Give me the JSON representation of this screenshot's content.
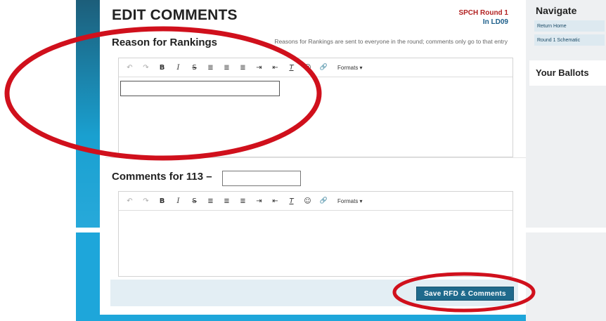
{
  "page": {
    "title": "EDIT COMMENTS",
    "round_name": "SPCH Round 1",
    "room": "In LD09"
  },
  "rfd": {
    "heading": "Reason for Rankings",
    "note": "Reasons for Rankings are sent to everyone in the round; comments only go to that entry",
    "input_value": ""
  },
  "comments": {
    "heading": "Comments for 113 –",
    "entry_name_value": ""
  },
  "toolbar": {
    "undo": "↶",
    "redo": "↷",
    "bold": "B",
    "italic": "I",
    "strike": "S",
    "align_left": "≣",
    "align_center": "≣",
    "align_right": "≣",
    "indent": "⇥",
    "outdent": "⇤",
    "clear_format": "T",
    "emoji": "☺",
    "link": "🔗",
    "formats": "Formats ▾"
  },
  "footer": {
    "save_label": "Save RFD & Comments"
  },
  "sidebar": {
    "navigate_title": "Navigate",
    "links": [
      "Return Home",
      "Round 1 Schematic"
    ],
    "ballots_title": "Your Ballots"
  },
  "colors": {
    "accent_blue": "#1ea6da",
    "button_bg": "#1f6a8c",
    "annotation_red": "#d0101c",
    "round_red": "#b22222"
  }
}
